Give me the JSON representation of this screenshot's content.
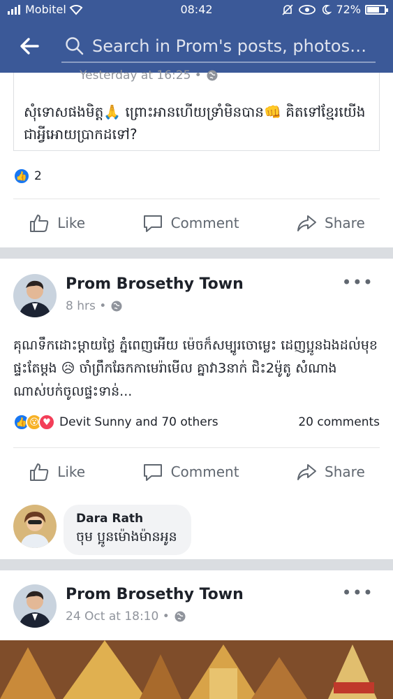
{
  "status": {
    "carrier": "Mobitel",
    "time": "08:42",
    "battery": "72%",
    "battery_level": 0.72
  },
  "search": {
    "placeholder": "Search in Prom's posts, photos an…"
  },
  "shared_post": {
    "time": "Yesterday at 16:25 •",
    "text": "សុំទោសផងមិត្ត🙏 ព្រោះអានហើយទ្រាំមិនបាន👊 គិតទៅខ្មែរយើង ជាអ្វីអោយប្រាកដទៅ?",
    "reaction_count": "2"
  },
  "actions": {
    "like": "Like",
    "comment": "Comment",
    "share": "Share"
  },
  "post1": {
    "name": "Prom Brosethy Town",
    "time": "8 hrs •",
    "text": "គុណទឹកដោះម្តាយថ្លៃ ភ្នំពេញអើយ ម៉េចក៏សម្បូរចោម្លេះ ដេញប្អូនឯងដល់មុខផ្ទះតែម្តង 😥 ចាំព្រឹកឆែកកាមេរ៉ាមើល គ្នាវា3នាក់ ជិះ2ម៉ូតូ សំណាងណាស់បក់ចូលផ្ទះទាន់...",
    "reactors": "Devit Sunny and 70 others",
    "comments": "20 comments"
  },
  "comment": {
    "name": "Dara Rath",
    "text": "ចុម ប្អូនម៉ោងម៉ានអូន"
  },
  "post2": {
    "name": "Prom Brosethy Town",
    "time": "24 Oct at 18:10 •"
  },
  "colors": {
    "brand": "#3b5998",
    "like_blue": "#1877f2",
    "love_red": "#f33e58",
    "wow_yellow": "#f7b125"
  }
}
